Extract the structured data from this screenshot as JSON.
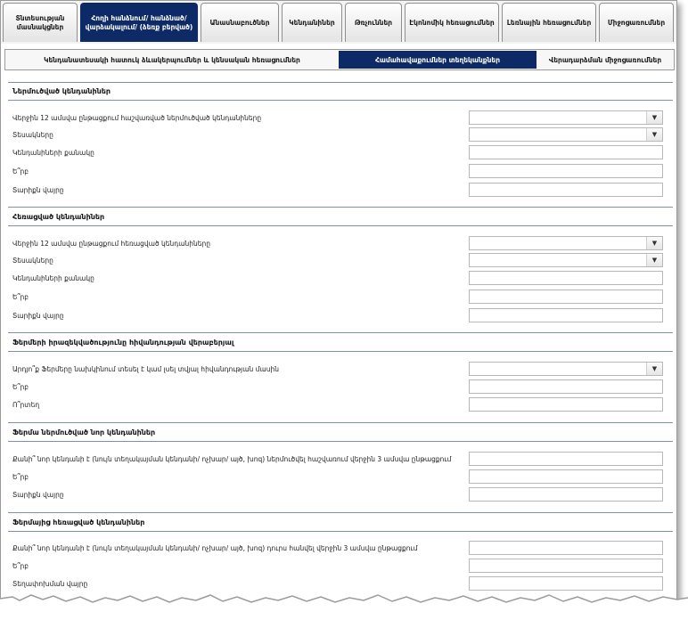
{
  "tabs": [
    {
      "label": "Տնտեսության մասնակցներ"
    },
    {
      "label": "Հողի հանձնում/ հանձնած/ վարձակալում/ (ձեռք բերված)",
      "active": true
    },
    {
      "label": "Անասնաբուծներ"
    },
    {
      "label": "Կենդանիներ"
    },
    {
      "label": "Թռչուններ"
    },
    {
      "label": "Էկոնոմիկ հեռացումներ"
    },
    {
      "label": "Լեռնային հեռացումներ"
    },
    {
      "label": "Միջոցառումներ"
    }
  ],
  "subtabs": [
    {
      "label": "Կենդանատեսակի հատուկ ձևակերպումներ և կենսական հեռացումներ"
    },
    {
      "label": "Համահավաքումներ տեղեկանքներ",
      "active": true
    },
    {
      "label": "Վերադարձման միջոցառումներ"
    }
  ],
  "sections": [
    {
      "title": "Ներմուծված կենդանիներ",
      "rows": [
        {
          "label": "Վերջին 12 ամսվա ընթացքում հաշվառված ներմուծված կենդանիները",
          "type": "select",
          "value": ""
        },
        {
          "label": "Տեսակները",
          "type": "select",
          "value": ""
        },
        {
          "label": "Կենդանիների քանակը",
          "type": "input",
          "value": ""
        },
        {
          "label": "Ե՞րբ",
          "type": "input",
          "value": ""
        },
        {
          "label": "Տարիքն վայրը",
          "type": "input",
          "value": ""
        }
      ]
    },
    {
      "title": "Հեռացված կենդանիներ",
      "rows": [
        {
          "label": "Վերջին 12 ամսվա ընթացքում հեռացված կենդանիները",
          "type": "select",
          "value": ""
        },
        {
          "label": "Տեսակները",
          "type": "select",
          "value": ""
        },
        {
          "label": "Կենդանիների քանակը",
          "type": "input",
          "value": ""
        },
        {
          "label": "Ե՞րբ",
          "type": "input",
          "value": ""
        },
        {
          "label": "Տարիքն վայրը",
          "type": "input",
          "value": ""
        }
      ]
    },
    {
      "title": "Ֆերմերի իրազեկվածությունը հիվանդության վերաբերյալ",
      "rows": [
        {
          "label": "Արդյո՞ք Ֆերմերը նախկինում տեսել է կամ լսել տվյալ հիվանդության մասին",
          "type": "select",
          "value": ""
        },
        {
          "label": "Ե՞րբ",
          "type": "input",
          "value": ""
        },
        {
          "label": "Ո՞րտեղ",
          "type": "input",
          "value": ""
        }
      ]
    },
    {
      "title": "Ֆերմա ներմուծված նոր կենդանիներ",
      "rows": [
        {
          "label": "Քանի՞ նոր կենդանի է (նույն տեղակայման կենդանի/ ոչխար/ այծ, խոզ) ներմուծվել հաշվառում վերջին 3 ամսվա ընթացքում",
          "type": "input",
          "value": ""
        },
        {
          "label": "Ե՞րբ",
          "type": "input",
          "value": ""
        },
        {
          "label": "Տարիքն վայրը",
          "type": "input",
          "value": ""
        }
      ]
    },
    {
      "title": "Ֆերմայից հեռացված կենդանիներ",
      "rows": [
        {
          "label": "Քանի՞ նոր կենդանի է (նույն տեղակայման կենդանի/ ոչխար/ այծ, խոզ) դուրս հանվել վերջին 3 ամսվա ընթացքում",
          "type": "input",
          "value": ""
        },
        {
          "label": "Ե՞րբ",
          "type": "input",
          "value": ""
        },
        {
          "label": "Տեղափոխման վայրը",
          "type": "input",
          "value": ""
        }
      ]
    }
  ],
  "icons": {
    "dropdown": "chevron-down-icon"
  }
}
